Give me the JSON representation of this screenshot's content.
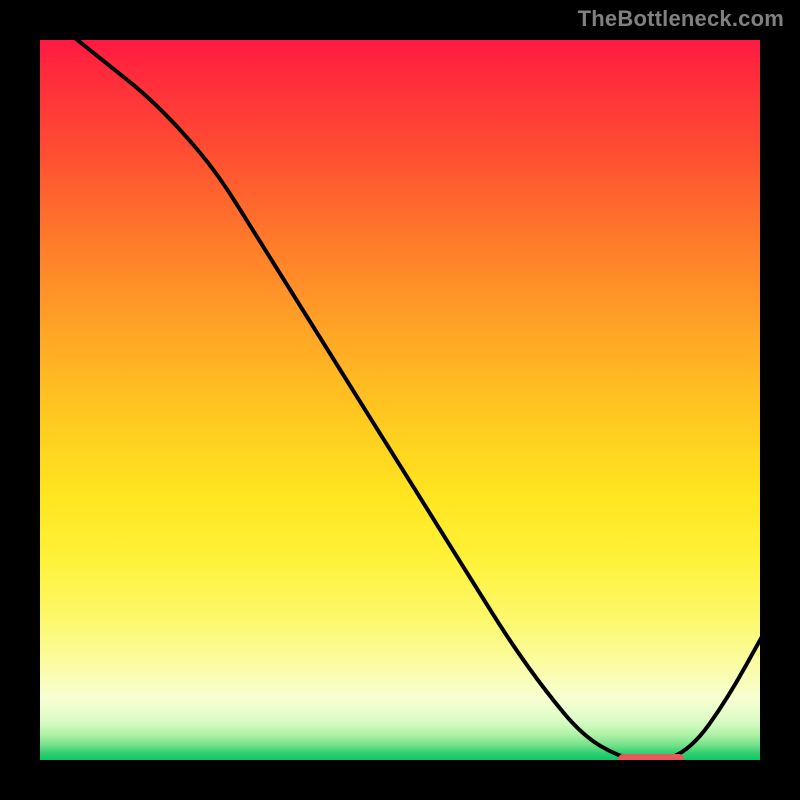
{
  "watermark": "TheBottleneck.com",
  "colors": {
    "background": "#000000",
    "curve": "#000000",
    "marker": "#e85a5a",
    "watermark": "#808080"
  },
  "chart_data": {
    "type": "line",
    "title": "",
    "xlabel": "",
    "ylabel": "",
    "xlim": [
      0,
      100
    ],
    "ylim": [
      0,
      100
    ],
    "grid": false,
    "legend": false,
    "series": [
      {
        "name": "bottleneck-curve",
        "x": [
          5,
          10,
          15,
          20,
          25,
          30,
          35,
          40,
          45,
          50,
          55,
          60,
          65,
          70,
          75,
          80,
          85,
          90,
          95,
          100
        ],
        "values": [
          100,
          96,
          92,
          87,
          81,
          73,
          65,
          57,
          49,
          41,
          33,
          25,
          17,
          10,
          4,
          1,
          0,
          2,
          9,
          18
        ]
      }
    ],
    "optimal_range": {
      "x_start": 80,
      "x_end": 89,
      "y": 0
    },
    "gradient_stops": [
      {
        "pos": 0.0,
        "color": "#ff1744"
      },
      {
        "pos": 0.5,
        "color": "#ffc820"
      },
      {
        "pos": 0.8,
        "color": "#fdf86a"
      },
      {
        "pos": 0.95,
        "color": "#aef2a6"
      },
      {
        "pos": 1.0,
        "color": "#00c060"
      }
    ]
  }
}
